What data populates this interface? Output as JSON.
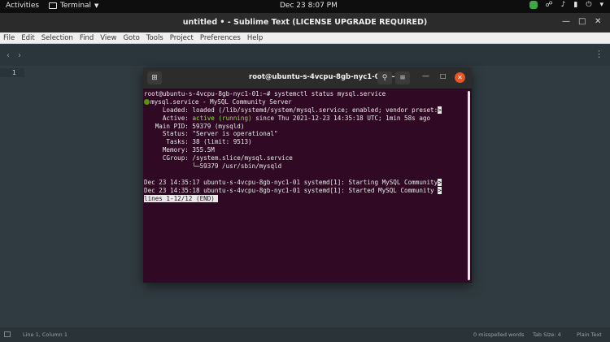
{
  "topbar": {
    "activities": "Activities",
    "app_name": "Terminal",
    "clock": "Dec 23  8:07 PM"
  },
  "window": {
    "title": "untitled • - Sublime Text (LICENSE UPGRADE REQUIRED)"
  },
  "menu": [
    "File",
    "Edit",
    "Selection",
    "Find",
    "View",
    "Goto",
    "Tools",
    "Project",
    "Preferences",
    "Help"
  ],
  "editor": {
    "line_number": "1"
  },
  "statusbar": {
    "position": "Line 1, Column 1",
    "spelling": "0 misspelled words",
    "tab_size": "Tab Size: 4",
    "syntax": "Plain Text"
  },
  "terminal": {
    "title": "root@ubuntu-s-4vcpu-8gb-nyc1-01: ~",
    "prompt": "root@ubuntu-s-4vcpu-8gb-nyc1-01:~# systemctl status mysql.service",
    "service_line": "mysql.service - MySQL Community Server",
    "loaded": "     Loaded: loaded (/lib/systemd/system/mysql.service; enabled; vendor preset:",
    "active_label": "     Active: ",
    "active_value": "active (running)",
    "active_rest": " since Thu 2021-12-23 14:35:18 UTC; 1min 58s ago",
    "main_pid": "   Main PID: 59379 (mysqld)",
    "status": "     Status: \"Server is operational\"",
    "tasks": "      Tasks: 38 (limit: 9513)",
    "memory": "     Memory: 355.5M",
    "cgroup": "     CGroup: /system.slice/mysql.service",
    "cgroup_child": "             └─59379 /usr/sbin/mysqld",
    "log1": "Dec 23 14:35:17 ubuntu-s-4vcpu-8gb-nyc1-01 systemd[1]: Starting MySQL Community",
    "log2": "Dec 23 14:35:18 ubuntu-s-4vcpu-8gb-nyc1-01 systemd[1]: Started MySQL Community ",
    "more_marker": ">",
    "pager": "lines 1-12/12 (END)"
  }
}
